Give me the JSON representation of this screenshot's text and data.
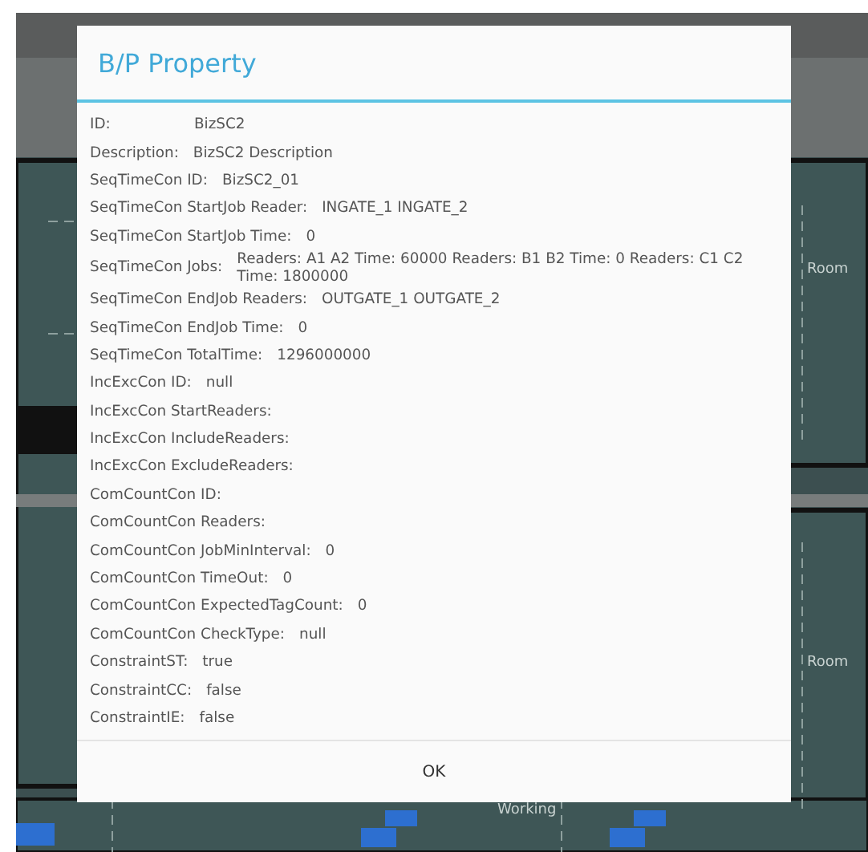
{
  "floor_plan": {
    "labels": [
      {
        "text": "Room"
      },
      {
        "text": "Room"
      },
      {
        "text": "Working"
      }
    ]
  },
  "dialog": {
    "title": "B/P Property",
    "rows": [
      {
        "label": "ID:",
        "value": "BizSC2"
      },
      {
        "label": "Description:",
        "value": "BizSC2 Description"
      },
      {
        "label": "SeqTimeCon ID:",
        "value": "BizSC2_01"
      },
      {
        "label": "SeqTimeCon StartJob Reader:",
        "value": "INGATE_1 INGATE_2"
      },
      {
        "label": "SeqTimeCon StartJob Time:",
        "value": "0"
      },
      {
        "label": "SeqTimeCon Jobs:",
        "value": "Readers: A1 A2 Time: 60000 Readers: B1 B2 Time: 0 Readers: C1 C2 Time: 1800000"
      },
      {
        "label": "SeqTimeCon EndJob Readers:",
        "value": "OUTGATE_1 OUTGATE_2"
      },
      {
        "label": "SeqTimeCon EndJob Time:",
        "value": "0"
      },
      {
        "label": "SeqTimeCon TotalTime:",
        "value": "1296000000"
      },
      {
        "label": "IncExcCon ID:",
        "value": "null"
      },
      {
        "label": "IncExcCon StartReaders:"
      },
      {
        "label": "IncExcCon IncludeReaders:"
      },
      {
        "label": "IncExcCon ExcludeReaders:"
      },
      {
        "label": "ComCountCon ID:"
      },
      {
        "label": "ComCountCon Readers:"
      },
      {
        "label": "ComCountCon JobMinInterval:",
        "value": "0"
      },
      {
        "label": "ComCountCon TimeOut:",
        "value": "0"
      },
      {
        "label": "ComCountCon ExpectedTagCount:",
        "value": "0"
      },
      {
        "label": "ComCountCon CheckType:",
        "value": "null"
      },
      {
        "label": "ConstraintST:",
        "value": "true"
      },
      {
        "label": "ConstraintCC:",
        "value": "false"
      },
      {
        "label": "ConstraintIE:",
        "value": "false"
      }
    ],
    "button": "OK"
  }
}
